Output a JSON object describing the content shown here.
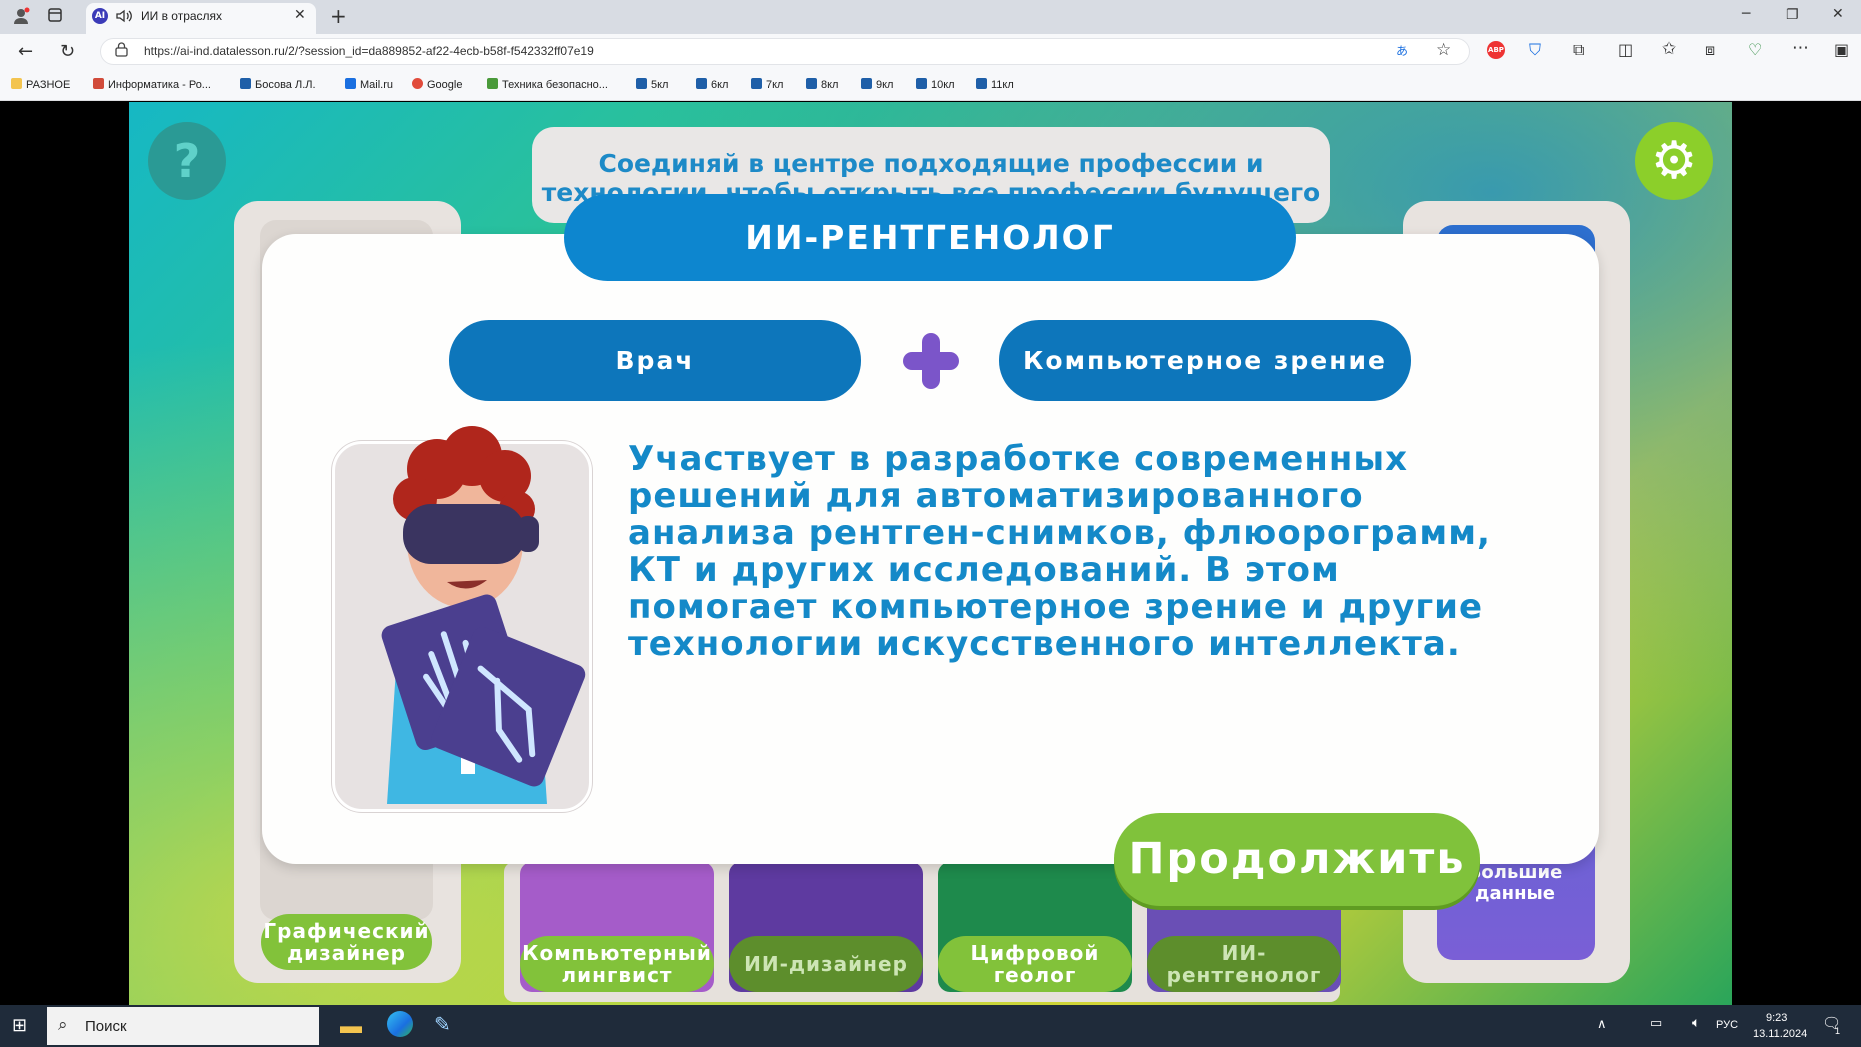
{
  "browser": {
    "tab_title": "ИИ в отраслях",
    "favicon_text": "AI",
    "url": "https://ai-ind.datalesson.ru/2/?session_id=da889852-af22-4ecb-b58f-f542332ff07e19",
    "bookmarks": [
      {
        "label": "РАЗНОЕ",
        "icon": "folder-icon"
      },
      {
        "label": "Информатика - Ро...",
        "icon": "pen-icon"
      },
      {
        "label": "Босова Л.Л.",
        "icon": "bosova-icon"
      },
      {
        "label": "Mail.ru",
        "icon": "shield-icon"
      },
      {
        "label": "Google",
        "icon": "google-icon"
      },
      {
        "label": "Техника безопасно...",
        "icon": "leaf-icon"
      },
      {
        "label": "5кл",
        "icon": "bosova-icon"
      },
      {
        "label": "6кл",
        "icon": "bosova-icon"
      },
      {
        "label": "7кл",
        "icon": "bosova-icon"
      },
      {
        "label": "8кл",
        "icon": "bosova-icon"
      },
      {
        "label": "9кл",
        "icon": "bosova-icon"
      },
      {
        "label": "10кл",
        "icon": "bosova-icon"
      },
      {
        "label": "11кл",
        "icon": "bosova-icon"
      }
    ]
  },
  "game": {
    "help_label": "?",
    "instruction": "Соединяй в центре подходящие профессии и технологии, чтобы открыть все профессии будущего",
    "modal": {
      "title": "ИИ-РЕНТГЕНОЛОГ",
      "profession": "Врач",
      "technology": "Компьютерное зрение",
      "description": "Участвует в разработке современных решений для автоматизированного анализа рентген-снимков, флюорограмм, КТ и других исследований.  В этом помогает компьютерное зрение и другие технологии искусственного интеллекта.",
      "continue_label": "Продолжить"
    },
    "left_card": "Графический дизайнер",
    "right_card": "Большие данные",
    "bottom_cards": [
      "Компьютерный лингвист",
      "ИИ-дизайнер",
      "Цифровой геолог",
      "ИИ-рентгенолог"
    ]
  },
  "taskbar": {
    "search_placeholder": "Поиск",
    "language": "РУС",
    "time": "9:23",
    "date": "13.11.2024",
    "notifications": "1"
  },
  "colors": {
    "accent_blue": "#0d86cf",
    "accent_green": "#80c23b",
    "plus_purple": "#7b55c9"
  }
}
